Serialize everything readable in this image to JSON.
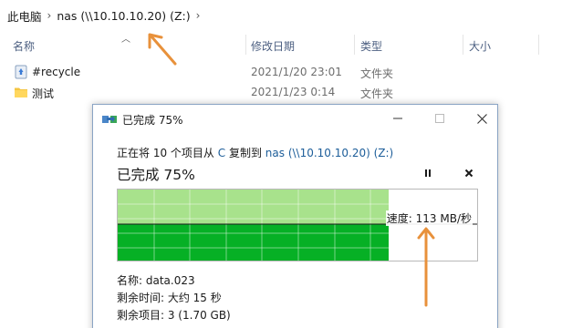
{
  "breadcrumb": {
    "root": "此电脑",
    "current": "nas (\\\\10.10.10.20) (Z:)",
    "chevron_icon": "chevron-right-icon",
    "dropdown_icon": "chevron-down-icon"
  },
  "columns": {
    "name": "名称",
    "modified": "修改日期",
    "type": "类型",
    "size": "大小"
  },
  "files": [
    {
      "icon": "recycle-folder-icon",
      "name": "#recycle",
      "modified": "2021/1/20 23:01",
      "type": "文件夹"
    },
    {
      "icon": "folder-icon",
      "name": "测试",
      "modified": "2021/1/23 0:14",
      "type": "文件夹"
    }
  ],
  "dialog": {
    "title": "已完成 75%",
    "status": {
      "prefix": "正在将 10 个项目从",
      "source": "C",
      "middle": "复制到",
      "dest": "nas (\\\\10.10.10.20) (Z:)"
    },
    "percent_label": "已完成 75%",
    "progress": 0.75,
    "speed_label": "速度: 113 MB/秒",
    "name_line": "名称: data.023",
    "time_left": "剩余时间: 大约 15 秒",
    "items_left": "剩余项目: 3 (1.70 GB)",
    "buttons": {
      "minimize_icon": "minimize-icon",
      "maximize_icon": "maximize-icon",
      "close_icon": "close-icon",
      "pause_icon": "pause-icon",
      "cancel_icon": "cancel-icon"
    }
  },
  "colors": {
    "progress_done": "#06b025",
    "progress_light": "#a8e28c",
    "link": "#1c5d99",
    "arrow": "#e8913b"
  }
}
